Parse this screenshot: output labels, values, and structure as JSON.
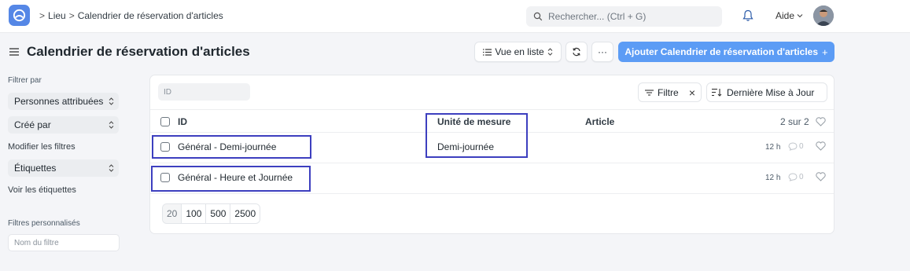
{
  "navbar": {
    "breadcrumb": [
      ">",
      "Lieu",
      ">",
      "Calendrier de réservation d'articles"
    ],
    "search_placeholder": "Rechercher... (Ctrl + G)",
    "help_label": "Aide"
  },
  "page": {
    "title": "Calendrier de réservation d'articles",
    "view_label": "Vue en liste",
    "more_label": "···",
    "add_label": "Ajouter Calendrier de réservation d'articles",
    "add_plus": "+"
  },
  "sidebar": {
    "filter_by": "Filtrer par",
    "assigned": "Personnes attribuées",
    "created_by": "Créé par",
    "edit_filters": "Modifier les filtres",
    "tags": "Étiquettes",
    "show_tags": "Voir les étiquettes",
    "custom_filters": "Filtres personnalisés",
    "filter_name_placeholder": "Nom du filtre"
  },
  "list": {
    "id_placeholder": "ID",
    "filter_label": "Filtre",
    "filter_clear": "×",
    "sort_label": "Dernière Mise à Jour",
    "columns": {
      "id": "ID",
      "uom": "Unité de mesure",
      "article": "Article"
    },
    "count": "2 sur 2",
    "rows": [
      {
        "id": "Général - Demi-journée",
        "uom": "Demi-journée",
        "time": "12 h",
        "comments": "0"
      },
      {
        "id": "Général - Heure et Journée",
        "uom": "",
        "time": "12 h",
        "comments": "0"
      }
    ],
    "page_sizes": [
      "20",
      "100",
      "500",
      "2500"
    ]
  },
  "colors": {
    "accent": "#5c9cf5",
    "highlight": "#3d3fbf"
  }
}
